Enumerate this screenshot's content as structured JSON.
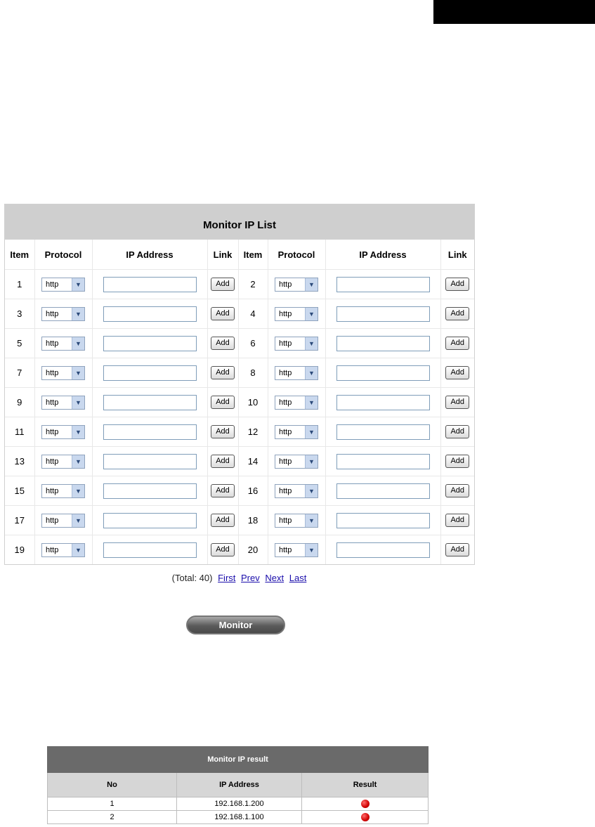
{
  "list": {
    "title": "Monitor IP List",
    "headers": [
      "Item",
      "Protocol",
      "IP Address",
      "Link",
      "Item",
      "Protocol",
      "IP Address",
      "Link"
    ],
    "rows": [
      {
        "left": {
          "item": "1",
          "protocol": "http",
          "ip": "",
          "link": "Add"
        },
        "right": {
          "item": "2",
          "protocol": "http",
          "ip": "",
          "link": "Add"
        }
      },
      {
        "left": {
          "item": "3",
          "protocol": "http",
          "ip": "",
          "link": "Add"
        },
        "right": {
          "item": "4",
          "protocol": "http",
          "ip": "",
          "link": "Add"
        }
      },
      {
        "left": {
          "item": "5",
          "protocol": "http",
          "ip": "",
          "link": "Add"
        },
        "right": {
          "item": "6",
          "protocol": "http",
          "ip": "",
          "link": "Add"
        }
      },
      {
        "left": {
          "item": "7",
          "protocol": "http",
          "ip": "",
          "link": "Add"
        },
        "right": {
          "item": "8",
          "protocol": "http",
          "ip": "",
          "link": "Add"
        }
      },
      {
        "left": {
          "item": "9",
          "protocol": "http",
          "ip": "",
          "link": "Add"
        },
        "right": {
          "item": "10",
          "protocol": "http",
          "ip": "",
          "link": "Add"
        }
      },
      {
        "left": {
          "item": "11",
          "protocol": "http",
          "ip": "",
          "link": "Add"
        },
        "right": {
          "item": "12",
          "protocol": "http",
          "ip": "",
          "link": "Add"
        }
      },
      {
        "left": {
          "item": "13",
          "protocol": "http",
          "ip": "",
          "link": "Add"
        },
        "right": {
          "item": "14",
          "protocol": "http",
          "ip": "",
          "link": "Add"
        }
      },
      {
        "left": {
          "item": "15",
          "protocol": "http",
          "ip": "",
          "link": "Add"
        },
        "right": {
          "item": "16",
          "protocol": "http",
          "ip": "",
          "link": "Add"
        }
      },
      {
        "left": {
          "item": "17",
          "protocol": "http",
          "ip": "",
          "link": "Add"
        },
        "right": {
          "item": "18",
          "protocol": "http",
          "ip": "",
          "link": "Add"
        }
      },
      {
        "left": {
          "item": "19",
          "protocol": "http",
          "ip": "",
          "link": "Add"
        },
        "right": {
          "item": "20",
          "protocol": "http",
          "ip": "",
          "link": "Add"
        }
      }
    ]
  },
  "pager": {
    "total": "(Total: 40)",
    "first": "First",
    "prev": "Prev",
    "next": "Next",
    "last": "Last"
  },
  "monitor_button": "Monitor",
  "result": {
    "title": "Monitor IP result",
    "headers": [
      "No",
      "IP Address",
      "Result"
    ],
    "rows": [
      {
        "no": "1",
        "ip": "192.168.1.200",
        "status": "red-status-icon"
      },
      {
        "no": "2",
        "ip": "192.168.1.100",
        "status": "red-status-icon"
      }
    ]
  },
  "colors": {
    "title_bar": "#cfcfcf",
    "result_title_bar": "#6a6a6a",
    "status_red": "#d10000",
    "link": "#1a0dab"
  }
}
